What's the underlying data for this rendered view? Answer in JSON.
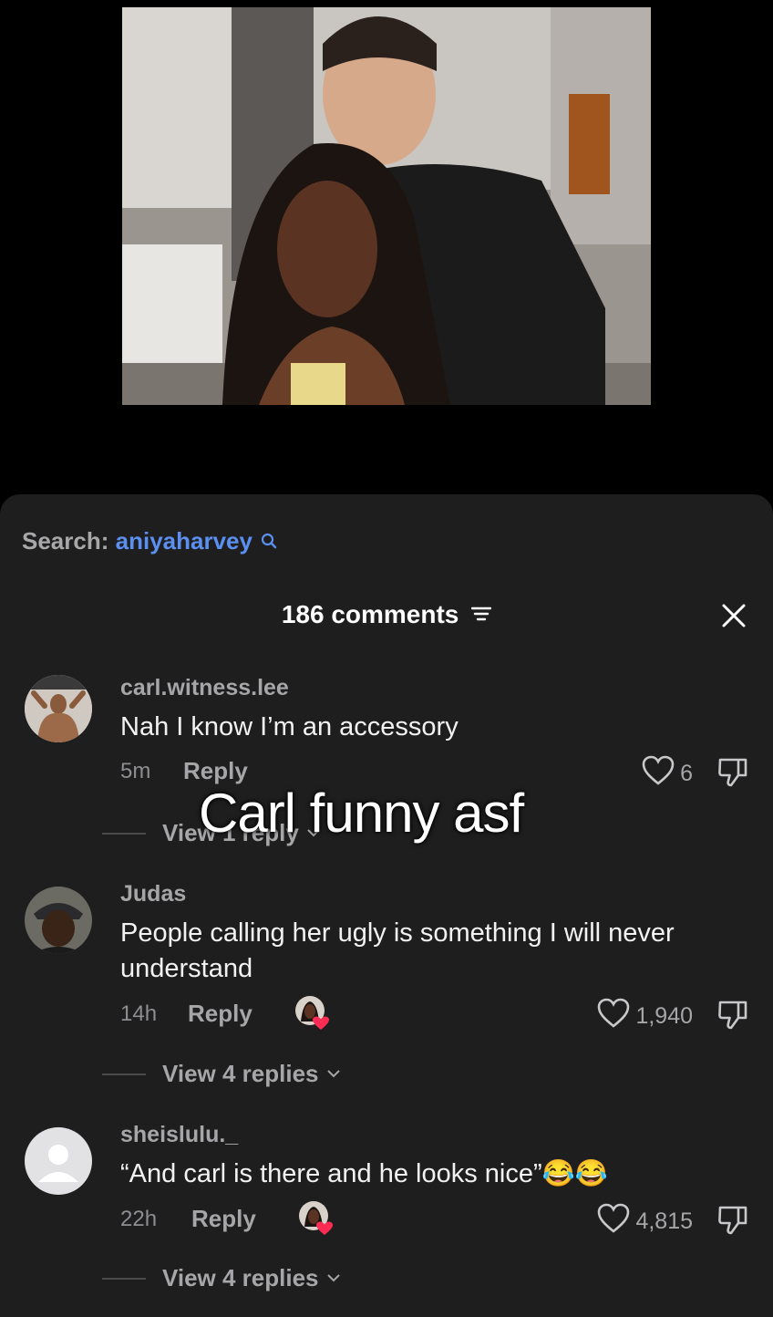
{
  "search": {
    "label": "Search:",
    "term": "aniyaharvey"
  },
  "comments_header": {
    "count_label": "186 comments"
  },
  "overlay_caption": "Carl funny asf",
  "comments": [
    {
      "username": "carl.witness.lee",
      "text": "Nah I know I’m an accessory",
      "time": "5m",
      "reply_label": "Reply",
      "likes": "6",
      "view_replies": "View 1 reply"
    },
    {
      "username": "Judas",
      "text": "People calling her ugly is something I will never understand",
      "time": "14h",
      "reply_label": "Reply",
      "likes": "1,940",
      "view_replies": "View 4 replies"
    },
    {
      "username": "sheislulu._",
      "text": "“And carl is there and he looks nice”😂😂",
      "time": "22h",
      "reply_label": "Reply",
      "likes": "4,815",
      "view_replies": "View 4 replies"
    }
  ],
  "colors": {
    "accent_link": "#5b8ff0",
    "sheet_bg": "#1e1e1f",
    "heart_red": "#fe2c55"
  }
}
